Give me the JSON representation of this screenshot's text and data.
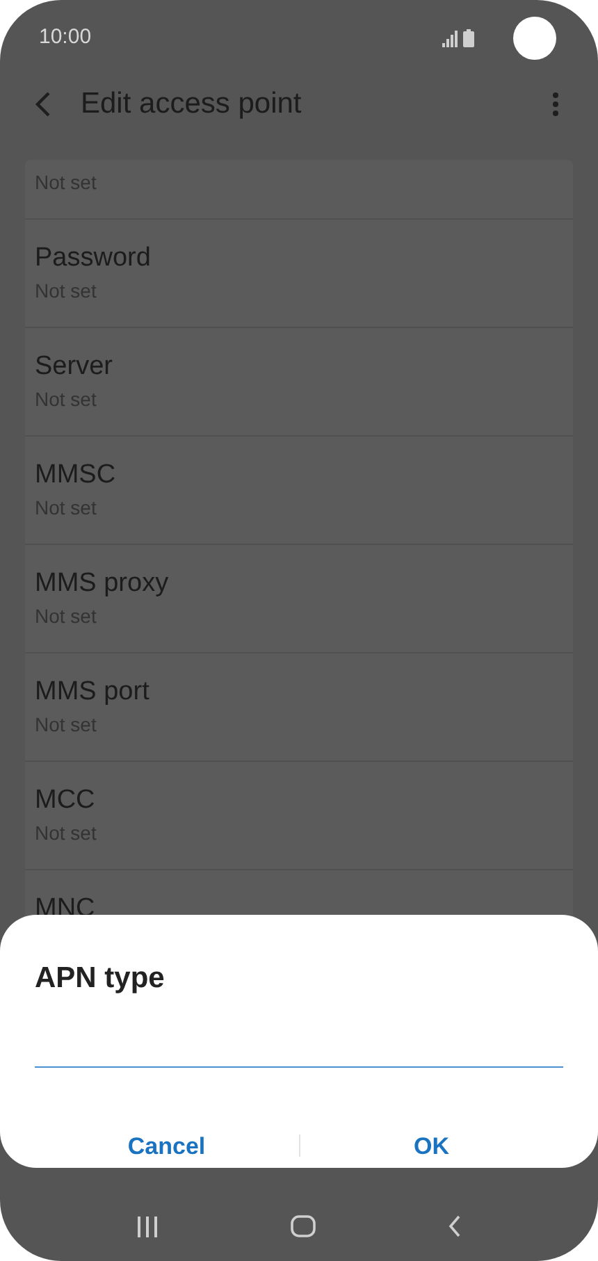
{
  "status_bar": {
    "time": "10:00"
  },
  "header": {
    "title": "Edit access point"
  },
  "settings": [
    {
      "value": "Not set"
    },
    {
      "label": "Password",
      "value": "Not set"
    },
    {
      "label": "Server",
      "value": "Not set"
    },
    {
      "label": "MMSC",
      "value": "Not set"
    },
    {
      "label": "MMS proxy",
      "value": "Not set"
    },
    {
      "label": "MMS port",
      "value": "Not set"
    },
    {
      "label": "MCC",
      "value": "Not set"
    },
    {
      "label": "MNC"
    }
  ],
  "dialog": {
    "title": "APN type",
    "buttons": [
      "Cancel",
      "OK"
    ]
  }
}
